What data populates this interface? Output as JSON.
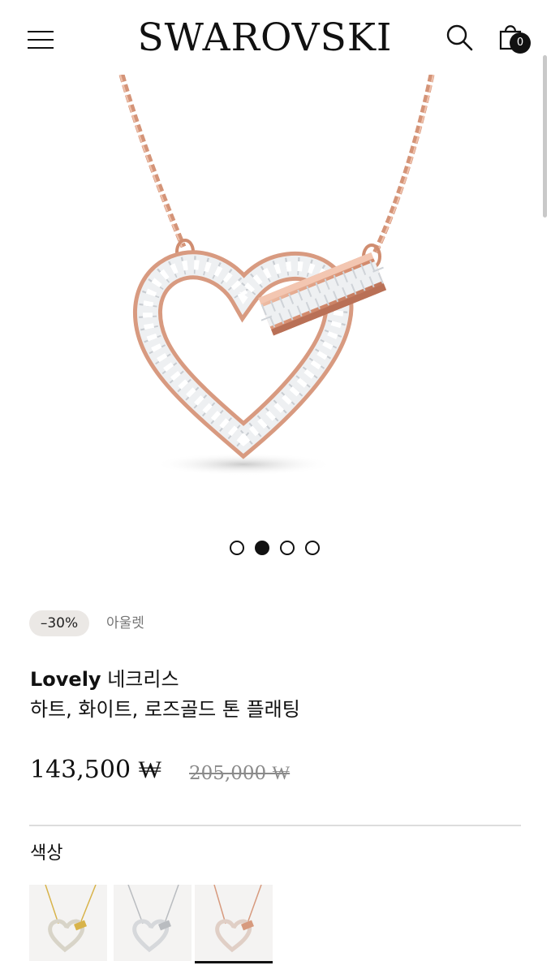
{
  "header": {
    "brand": "SWAROVSKI",
    "cart_count": "0",
    "icons": [
      "menu-icon",
      "search-icon",
      "shopping-bag-icon"
    ]
  },
  "gallery": {
    "total_slides": 4,
    "active_slide": 2
  },
  "product": {
    "discount": "–30%",
    "category": "아울렛",
    "name": "Lovely",
    "type": "네크리스",
    "subtitle": "하트, 화이트, 로즈골드 톤 플래팅",
    "price": "143,500 ₩",
    "original_price": "205,000 ₩"
  },
  "color_section": {
    "label": "색상",
    "swatches": [
      {
        "metal": "gold",
        "color": "#d8b34a"
      },
      {
        "metal": "rhodium",
        "color": "#b9bcc0"
      },
      {
        "metal": "rose-gold",
        "color": "#d79a7e",
        "selected": true
      }
    ]
  },
  "colors": {
    "rose_gold": "#d9957a",
    "badge_bg": "#ebe8e5"
  }
}
